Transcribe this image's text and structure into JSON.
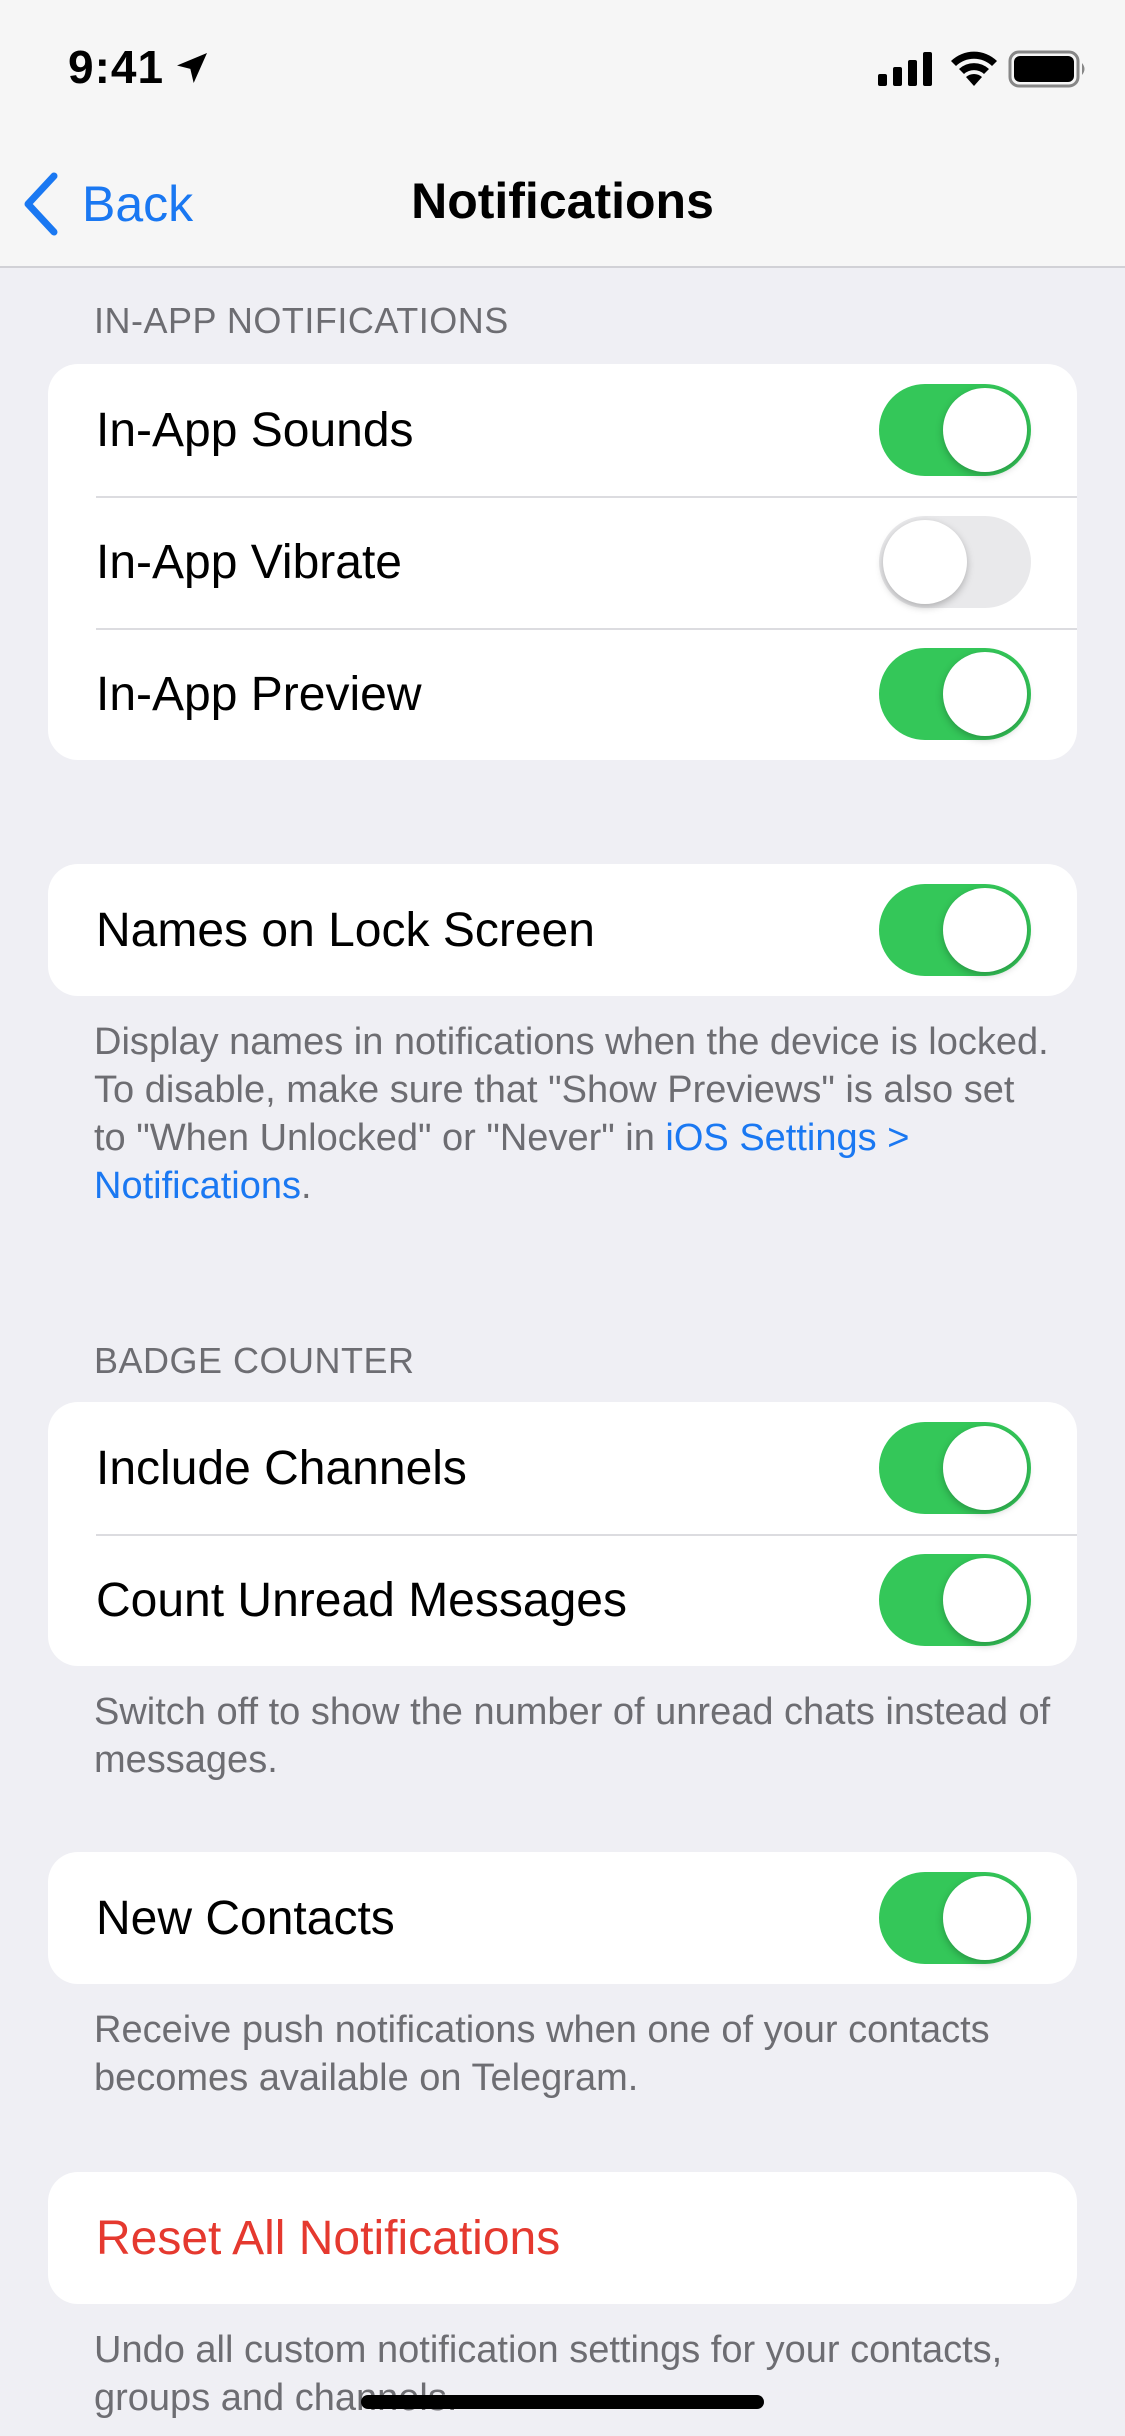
{
  "status_bar": {
    "time": "9:41",
    "icons": [
      "location-arrow-icon",
      "cellular-signal-icon",
      "wifi-icon",
      "battery-icon"
    ]
  },
  "nav": {
    "back_label": "Back",
    "title": "Notifications"
  },
  "sections": {
    "in_app": {
      "header": "IN-APP NOTIFICATIONS",
      "rows": [
        {
          "label": "In-App Sounds",
          "on": true
        },
        {
          "label": "In-App Vibrate",
          "on": false
        },
        {
          "label": "In-App Preview",
          "on": true
        }
      ]
    },
    "lock_screen": {
      "rows": [
        {
          "label": "Names on Lock Screen",
          "on": true
        }
      ],
      "footer_text": "Display names in notifications when the device is locked. To disable, make sure that \"Show Previews\" is also set to \"When Unlocked\" or \"Never\" in ",
      "footer_link": "iOS Settings > Notifications",
      "footer_end": "."
    },
    "badge": {
      "header": "BADGE COUNTER",
      "rows": [
        {
          "label": "Include Channels",
          "on": true
        },
        {
          "label": "Count Unread Messages",
          "on": true
        }
      ],
      "footer": "Switch off to show the number of unread chats instead of messages."
    },
    "contacts": {
      "rows": [
        {
          "label": "New Contacts",
          "on": true
        }
      ],
      "footer": "Receive push notifications when one of your contacts becomes available on Telegram."
    },
    "reset": {
      "label": "Reset All Notifications",
      "footer": "Undo all custom notification settings for your contacts, groups and channels."
    }
  },
  "colors": {
    "accent": "#1a78f2",
    "toggle_on": "#34c759",
    "destructive": "#e5392f",
    "background": "#efeff4"
  }
}
